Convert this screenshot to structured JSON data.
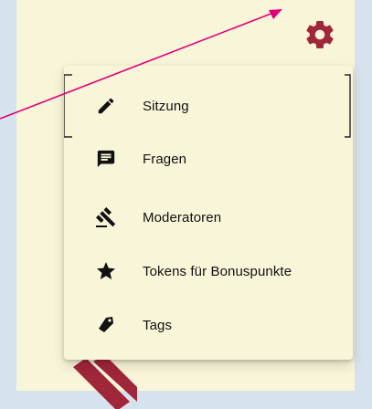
{
  "colors": {
    "background": "#d6e3ee",
    "panel": "#f8f5d8",
    "gear": "#a0263a",
    "annotation_arrow": "#e0007a",
    "icon": "#111111"
  },
  "settings_button": {
    "icon": "gear-icon"
  },
  "menu": {
    "items": [
      {
        "label": "Sitzung",
        "icon": "pencil-icon"
      },
      {
        "label": "Fragen",
        "icon": "chat-bubble-icon"
      },
      {
        "label": "Moderatoren",
        "icon": "gavel-icon"
      },
      {
        "label": "Tokens für Bonuspunkte",
        "icon": "star-icon"
      },
      {
        "label": "Tags",
        "icon": "tag-icon"
      }
    ]
  }
}
